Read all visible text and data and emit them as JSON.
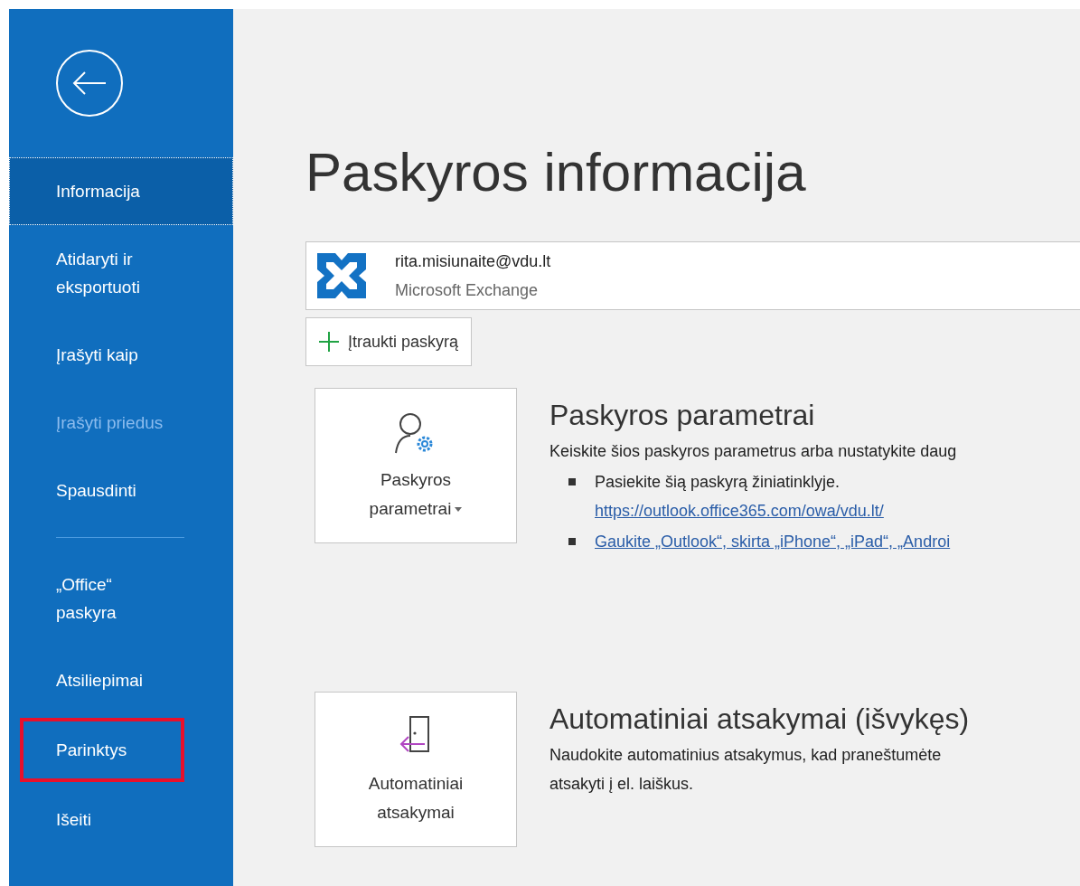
{
  "sidebar": {
    "groups": [
      {
        "items": [
          {
            "label": "Informacija",
            "selected": true,
            "disabled": false,
            "highlighted": false
          },
          {
            "label": "Atidaryti ir eksportuoti",
            "selected": false,
            "disabled": false,
            "highlighted": false
          },
          {
            "label": "Įrašyti kaip",
            "selected": false,
            "disabled": false,
            "highlighted": false
          },
          {
            "label": "Įrašyti priedus",
            "selected": false,
            "disabled": true,
            "highlighted": false
          },
          {
            "label": "Spausdinti",
            "selected": false,
            "disabled": false,
            "highlighted": false
          }
        ]
      },
      {
        "items": [
          {
            "label": "„Office“ paskyra",
            "selected": false,
            "disabled": false,
            "highlighted": false
          },
          {
            "label": "Atsiliepimai",
            "selected": false,
            "disabled": false,
            "highlighted": false
          },
          {
            "label": "Parinktys",
            "selected": false,
            "disabled": false,
            "highlighted": true
          },
          {
            "label": "Išeiti",
            "selected": false,
            "disabled": false,
            "highlighted": false
          }
        ]
      }
    ]
  },
  "title": "Paskyros informacija",
  "account": {
    "email": "rita.misiunaite@vdu.lt",
    "type": "Microsoft Exchange"
  },
  "add_account_button": "Įtraukti paskyrą",
  "sections": [
    {
      "kind": "settings",
      "button": "Paskyros parametrai",
      "heading": "Paskyros parametrai",
      "description": "Keiskite šios paskyros parametrus arba nustatykite daug",
      "bullets": [
        {
          "text": "Pasiekite šią paskyrą žiniatinklyje.",
          "link": "https://outlook.office365.com/owa/vdu.lt/"
        },
        {
          "link": "Gaukite „Outlook“, skirta „iPhone“, „iPad“, „Androi"
        }
      ]
    },
    {
      "kind": "auto-reply",
      "button": "Automatiniai atsakymai",
      "heading": "Automatiniai atsakymai (išvykęs)",
      "description": "Naudokite automatinius atsakymus, kad praneštumėte",
      "description_2": "atsakyti į el. laiškus."
    }
  ]
}
